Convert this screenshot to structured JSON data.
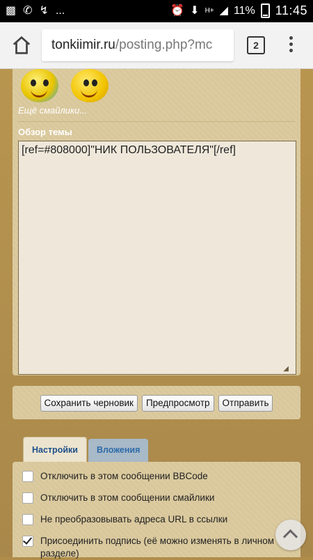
{
  "status_bar": {
    "time": "11:45",
    "battery": "11%",
    "ellipsis": "...",
    "icons": [
      "chat-icon",
      "whatsapp-icon",
      "missed-call-icon",
      "alarm-icon",
      "download-icon",
      "hplus-icon",
      "signal-icon"
    ]
  },
  "browser": {
    "url_host": "tonkiimir.ru",
    "url_path": "/posting.php?mc",
    "tab_count": "2"
  },
  "smileys": {
    "more_link": "Ещё смайлики..."
  },
  "topic_review": {
    "label": "Обзор темы",
    "text": "[ref=#808000]\"НИК ПОЛЬЗОВАТЕЛЯ\"[/ref]"
  },
  "buttons": {
    "save_draft": "Сохранить черновик",
    "preview": "Предпросмотр",
    "submit": "Отправить"
  },
  "tabs": [
    {
      "label": "Настройки",
      "active": true
    },
    {
      "label": "Вложения",
      "active": false
    }
  ],
  "options": [
    {
      "label": "Отключить в этом сообщении BBCode",
      "checked": false
    },
    {
      "label": "Отключить в этом сообщении смайлики",
      "checked": false
    },
    {
      "label": "Не преобразовывать адреса URL в ссылки",
      "checked": false
    },
    {
      "label": "Присоединить подпись (её можно изменять в личном разделе)",
      "checked": true
    }
  ]
}
